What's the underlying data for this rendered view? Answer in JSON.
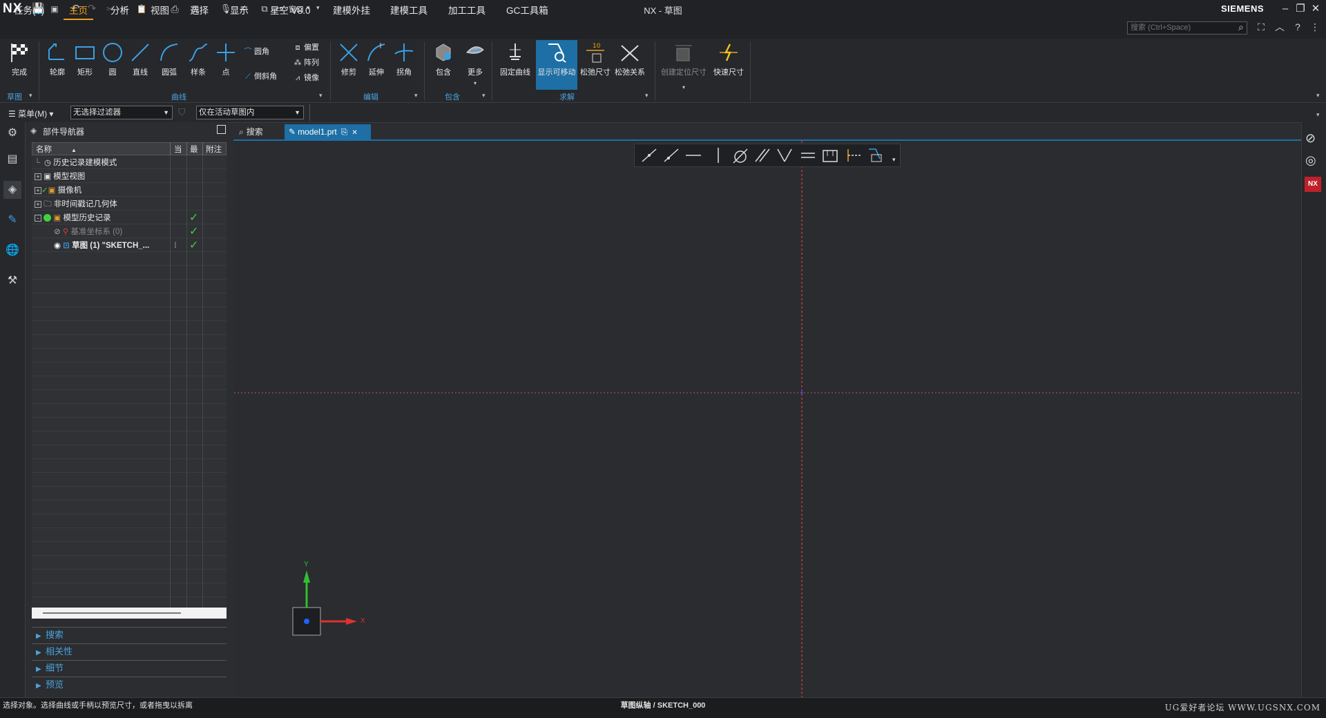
{
  "app": {
    "logo": "NX",
    "window_title": "NX - 草图",
    "brand": "SIEMENS",
    "window_min": "–",
    "window_restore": "❐",
    "window_close": "✕",
    "window_menu_label": "窗口"
  },
  "menu_tabs": [
    "任务(T)",
    "主页",
    "分析",
    "视图",
    "选择",
    "显示",
    "星空 V8.0",
    "建模外挂",
    "建模工具",
    "加工工具",
    "GC工具箱"
  ],
  "active_tab": "主页",
  "search": {
    "placeholder": "搜索 (Ctrl+Space)"
  },
  "ribbon": {
    "finish_label": "完成",
    "sketch_group": "草图",
    "curve_group": "曲线",
    "curve_buttons": [
      "轮廓",
      "矩形",
      "圆",
      "直线",
      "圆弧",
      "样条",
      "点"
    ],
    "fillet_label": "圆角",
    "chamfer_label": "倒斜角",
    "offset_label": "偏置",
    "pattern_label": "阵列",
    "mirror_label": "镜像",
    "edit_group": "编辑",
    "edit_buttons": [
      "修剪",
      "延伸",
      "拐角"
    ],
    "include_group": "包含",
    "include_buttons": [
      "包含",
      "更多"
    ],
    "solve_group": "求解",
    "solve_buttons": [
      "固定曲线",
      "显示可移动",
      "松弛尺寸",
      "松弛关系"
    ],
    "relax_dim_value": "10",
    "dim_buttons": [
      "创建定位尺寸",
      "快速尺寸"
    ]
  },
  "filterbar": {
    "menu_label": "菜单(M)",
    "filter_value": "无选择过滤器",
    "scope_value": "仅在活动草图内"
  },
  "navigator": {
    "title": "部件导航器",
    "columns": [
      "名称",
      "当",
      "最",
      "附注"
    ],
    "rows": [
      {
        "label": "历史记录建模模式",
        "indent": 0,
        "expand": "",
        "check": ""
      },
      {
        "label": "模型视图",
        "indent": 0,
        "expand": "+",
        "check": ""
      },
      {
        "label": "摄像机",
        "indent": 0,
        "expand": "+",
        "check": ""
      },
      {
        "label": "非时间戳记几何体",
        "indent": 0,
        "expand": "+",
        "check": ""
      },
      {
        "label": "模型历史记录",
        "indent": 0,
        "expand": "-",
        "check": "✓"
      },
      {
        "label": "基准坐标系 (0)",
        "indent": 1,
        "expand": "",
        "check": "✓"
      },
      {
        "label": "草图 (1) \"SKETCH_...",
        "indent": 1,
        "expand": "",
        "check": "✓"
      }
    ],
    "sections": [
      "搜索",
      "相关性",
      "细节",
      "预览"
    ]
  },
  "tabs": {
    "search_label": "搜索",
    "model_label": "model1.prt"
  },
  "axes": {
    "x_label": "X",
    "y_label": "Y"
  },
  "status": {
    "left_text": "选择对象。选择曲线或手柄以预览尺寸，或者拖曳以拆离",
    "center_text": "草图纵轴 / SKETCH_000",
    "watermark": "UG爱好者论坛 WWW.UGSNX.COM"
  },
  "colors": {
    "accent_blue": "#1d6fa5",
    "active_tab": "#f0a020",
    "check": "#3fd23f"
  }
}
